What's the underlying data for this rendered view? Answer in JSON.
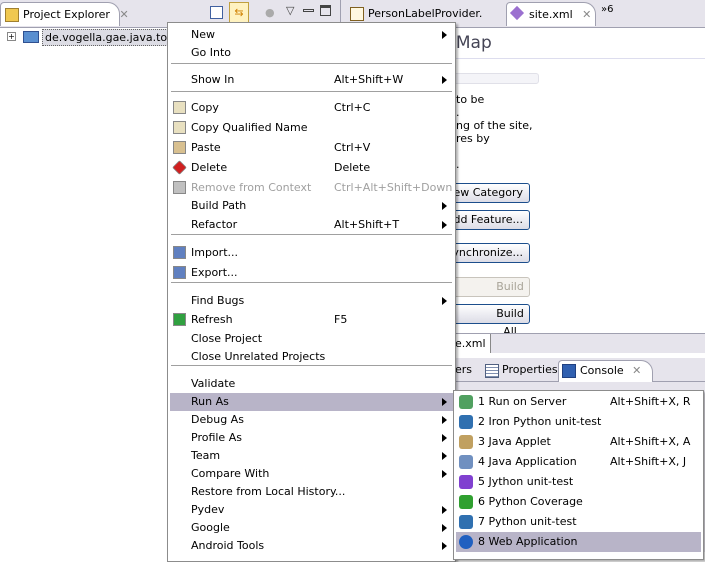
{
  "explorer": {
    "title": "Project Explorer",
    "project": "de.vogella.gae.java.todo"
  },
  "editor": {
    "tabs": [
      {
        "label": "PersonLabelProvider."
      },
      {
        "label": "site.xml"
      }
    ],
    "overflow": "»6",
    "heading": "e Map",
    "text": [
      "to be",
      ".",
      "ng of the site,",
      "res by",
      "."
    ],
    "buttons": {
      "new_category": "New Category",
      "add_feature": "Add Feature...",
      "synchronize": "Synchronize...",
      "build": "Build",
      "build_all": "Build All"
    },
    "bottom_tab": "e.xml"
  },
  "bottom": {
    "tabs": [
      {
        "label": "ers"
      },
      {
        "label": "Properties"
      },
      {
        "label": "Console"
      }
    ]
  },
  "menu": {
    "items": [
      {
        "label": "New",
        "submenu": true
      },
      {
        "label": "Go Into"
      },
      {
        "label": "Show In",
        "shortcut": "Alt+Shift+W",
        "submenu": true
      },
      {
        "label": "Copy",
        "shortcut": "Ctrl+C",
        "icon": "copy-icon"
      },
      {
        "label": "Copy Qualified Name",
        "icon": "copy-qualified-icon"
      },
      {
        "label": "Paste",
        "shortcut": "Ctrl+V",
        "icon": "paste-icon"
      },
      {
        "label": "Delete",
        "shortcut": "Delete",
        "icon": "delete-icon"
      },
      {
        "label": "Remove from Context",
        "shortcut": "Ctrl+Alt+Shift+Down",
        "disabled": true,
        "icon": "remove-context-icon"
      },
      {
        "label": "Build Path",
        "submenu": true
      },
      {
        "label": "Refactor",
        "shortcut": "Alt+Shift+T",
        "submenu": true
      },
      {
        "label": "Import...",
        "icon": "import-icon"
      },
      {
        "label": "Export...",
        "icon": "export-icon"
      },
      {
        "label": "Find Bugs",
        "submenu": true
      },
      {
        "label": "Refresh",
        "shortcut": "F5",
        "icon": "refresh-icon"
      },
      {
        "label": "Close Project"
      },
      {
        "label": "Close Unrelated Projects"
      },
      {
        "label": "Validate"
      },
      {
        "label": "Run As",
        "submenu": true,
        "highlighted": true
      },
      {
        "label": "Debug As",
        "submenu": true
      },
      {
        "label": "Profile As",
        "submenu": true
      },
      {
        "label": "Team",
        "submenu": true
      },
      {
        "label": "Compare With",
        "submenu": true
      },
      {
        "label": "Restore from Local History..."
      },
      {
        "label": "Pydev",
        "submenu": true
      },
      {
        "label": "Google",
        "submenu": true
      },
      {
        "label": "Android Tools",
        "submenu": true
      }
    ]
  },
  "submenu": {
    "items": [
      {
        "label": "1 Run on Server",
        "shortcut": "Alt+Shift+X, R",
        "icon": "server-icon"
      },
      {
        "label": "2 Iron Python unit-test",
        "icon": "python-unittest-icon"
      },
      {
        "label": "3 Java Applet",
        "shortcut": "Alt+Shift+X, A",
        "icon": "java-applet-icon"
      },
      {
        "label": "4 Java Application",
        "shortcut": "Alt+Shift+X, J",
        "icon": "java-application-icon"
      },
      {
        "label": "5 Jython unit-test",
        "icon": "jython-unittest-icon"
      },
      {
        "label": "6 Python Coverage",
        "icon": "python-coverage-icon"
      },
      {
        "label": "7 Python unit-test",
        "icon": "python-unittest-icon"
      },
      {
        "label": "8 Web Application",
        "icon": "google-web-app-icon",
        "highlighted": true
      }
    ]
  },
  "colors": {
    "highlight": "#b8b4c8",
    "button_border": "#1c4e8c",
    "tabbar": "#e6e4ec"
  }
}
